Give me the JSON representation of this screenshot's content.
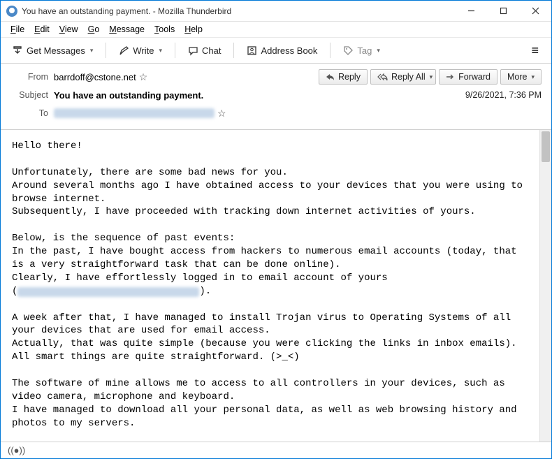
{
  "window": {
    "title": "You have an outstanding payment. - Mozilla Thunderbird"
  },
  "menu": {
    "file": "File",
    "edit": "Edit",
    "view": "View",
    "go": "Go",
    "message": "Message",
    "tools": "Tools",
    "help": "Help"
  },
  "toolbar": {
    "get_messages": "Get Messages",
    "write": "Write",
    "chat": "Chat",
    "address_book": "Address Book",
    "tag": "Tag"
  },
  "header": {
    "from_label": "From",
    "from_value": "barrdoff@cstone.net",
    "subject_label": "Subject",
    "subject_value": "You have an outstanding payment.",
    "to_label": "To",
    "date": "9/26/2021, 7:36 PM",
    "reply": "Reply",
    "reply_all": "Reply All",
    "forward": "Forward",
    "more": "More"
  },
  "body": {
    "l1": "Hello there!",
    "l2": "Unfortunately, there are some bad news for you.",
    "l3": "Around several months ago I have obtained access to your devices that you were using to browse internet.",
    "l4": "Subsequently, I have proceeded with tracking down internet activities of yours.",
    "l5": "Below, is the sequence of past events:",
    "l6": "In the past, I have bought access from hackers to numerous email accounts (today, that is a very straightforward task that can be done online).",
    "l7": "Clearly, I have effortlessly logged in to email account of yours",
    "l7b": "(",
    "l7c": ").",
    "l8": "A week after that, I have managed to install Trojan virus to Operating Systems of all your devices that are used for email access.",
    "l9": "Actually, that was quite simple (because you were clicking the links in inbox emails).",
    "l10": "All smart things are quite straightforward. (>_<)",
    "l11": "The software of mine allows me to access to all controllers in your devices, such as video camera, microphone and keyboard.",
    "l12": "I have managed to download all your personal data, as well as web browsing history and photos to my servers."
  },
  "status": {
    "icon": "((●))"
  }
}
